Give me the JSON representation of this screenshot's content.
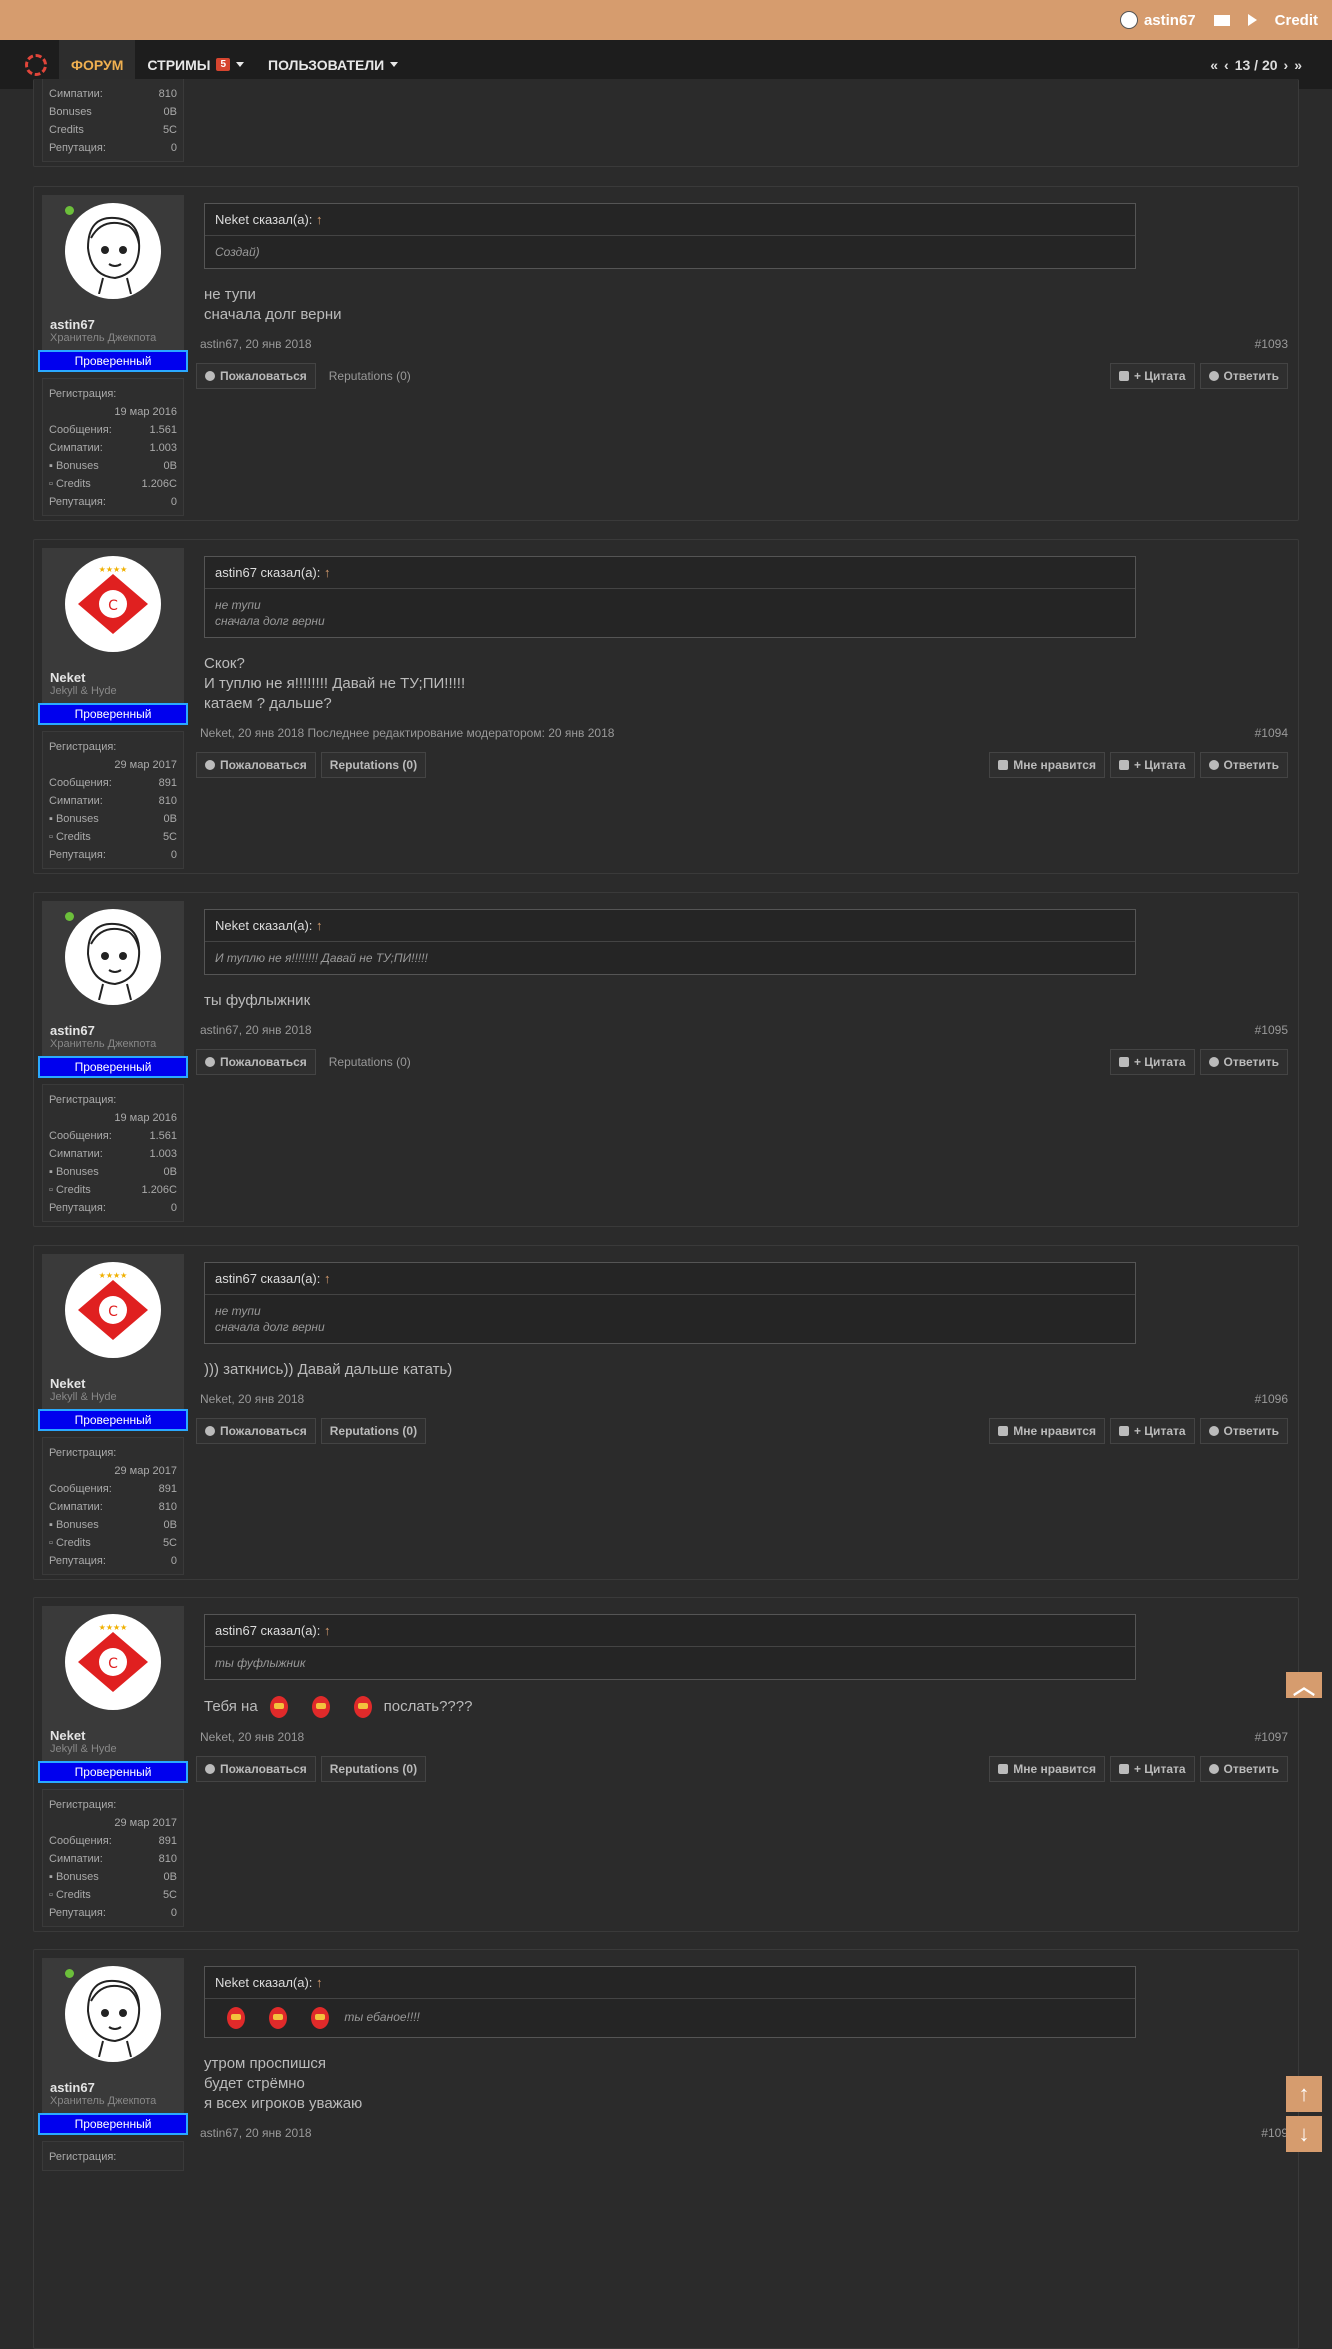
{
  "topbar": {
    "username": "astin67",
    "credit_label": "Credit"
  },
  "nav": {
    "forum": "ФОРУМ",
    "streams": "СТРИМЫ",
    "streams_badge": "5",
    "users": "ПОЛЬЗОВАТЕЛИ",
    "pager": "13 / 20"
  },
  "labels": {
    "reg": "Регистрация:",
    "msgs": "Сообщения:",
    "likes": "Симпатии:",
    "bonuses": "Bonuses",
    "credits": "Credits",
    "rep": "Репутация:",
    "verified": "Проверенный",
    "report": "Пожаловаться",
    "like": "Мне нравится",
    "quote": "+ Цитата",
    "reply": "Ответить"
  },
  "top_stats": {
    "likes": "810",
    "bonuses": "0B",
    "credits": "5C",
    "rep": "0"
  },
  "posts": [
    {
      "user": "astin67",
      "title": "Хранитель Джекпота",
      "reg": "19 мар 2016",
      "msgs": "1.561",
      "likes": "1.003",
      "bonuses": "0B",
      "credits": "1.206C",
      "rep": "0",
      "quote_author": "Neket сказал(а):",
      "quote_lines": [
        "Создай)"
      ],
      "text": [
        "не тупи",
        "сначала долг верни"
      ],
      "meta": "astin67, 20 янв 2018",
      "num": "#1093",
      "reputations": "Reputations (0)"
    },
    {
      "user": "Neket",
      "title": "Jekyll & Hyde",
      "reg": "29 мар 2017",
      "msgs": "891",
      "likes": "810",
      "bonuses": "0B",
      "credits": "5C",
      "rep": "0",
      "quote_author": "astin67 сказал(а):",
      "quote_lines": [
        "не тупи",
        "сначала долг верни"
      ],
      "text": [
        "Скок?",
        "И туплю не я!!!!!!!! Давай не ТУ;ПИ!!!!!",
        "катаем ? дальше?"
      ],
      "meta": "Neket, 20 янв 2018   Последнее редактирование модератором: 20 янв 2018",
      "num": "#1094",
      "reputations": "Reputations (0)"
    },
    {
      "user": "astin67",
      "title": "Хранитель Джекпота",
      "reg": "19 мар 2016",
      "msgs": "1.561",
      "likes": "1.003",
      "bonuses": "0B",
      "credits": "1.206C",
      "rep": "0",
      "quote_author": "Neket сказал(а):",
      "quote_lines": [
        "И туплю не я!!!!!!!! Давай не ТУ;ПИ!!!!!"
      ],
      "text": [
        "ты фуфлыжник"
      ],
      "meta": "astin67, 20 янв 2018",
      "num": "#1095",
      "reputations": "Reputations (0)"
    },
    {
      "user": "Neket",
      "title": "Jekyll & Hyde",
      "reg": "29 мар 2017",
      "msgs": "891",
      "likes": "810",
      "bonuses": "0B",
      "credits": "5C",
      "rep": "0",
      "quote_author": "astin67 сказал(а):",
      "quote_lines": [
        "не тупи",
        "сначала долг верни"
      ],
      "text": [
        " ))) заткнись)) Давай дальше катать)"
      ],
      "meta": "Neket, 20 янв 2018",
      "num": "#1096",
      "reputations": "Reputations (0)"
    },
    {
      "user": "Neket",
      "title": "Jekyll & Hyde",
      "reg": "29 мар 2017",
      "msgs": "891",
      "likes": "810",
      "bonuses": "0B",
      "credits": "5C",
      "rep": "0",
      "quote_author": "astin67 сказал(а):",
      "quote_lines": [
        "ты фуфлыжник"
      ],
      "text_before": "Тебя на",
      "text_after": "послать????",
      "meta": "Neket, 20 янв 2018",
      "num": "#1097",
      "reputations": "Reputations (0)"
    },
    {
      "user": "astin67",
      "title": "Хранитель Джекпота",
      "reg": "Регистрация:",
      "quote_author": "Neket сказал(а):",
      "quote_lines": [
        "ты ебаное!!!!"
      ],
      "text": [
        "утром проспишся",
        "будет стрёмно",
        "я всех игроков уважаю"
      ],
      "meta": "astin67, 20 янв 2018",
      "num": "#109"
    }
  ]
}
